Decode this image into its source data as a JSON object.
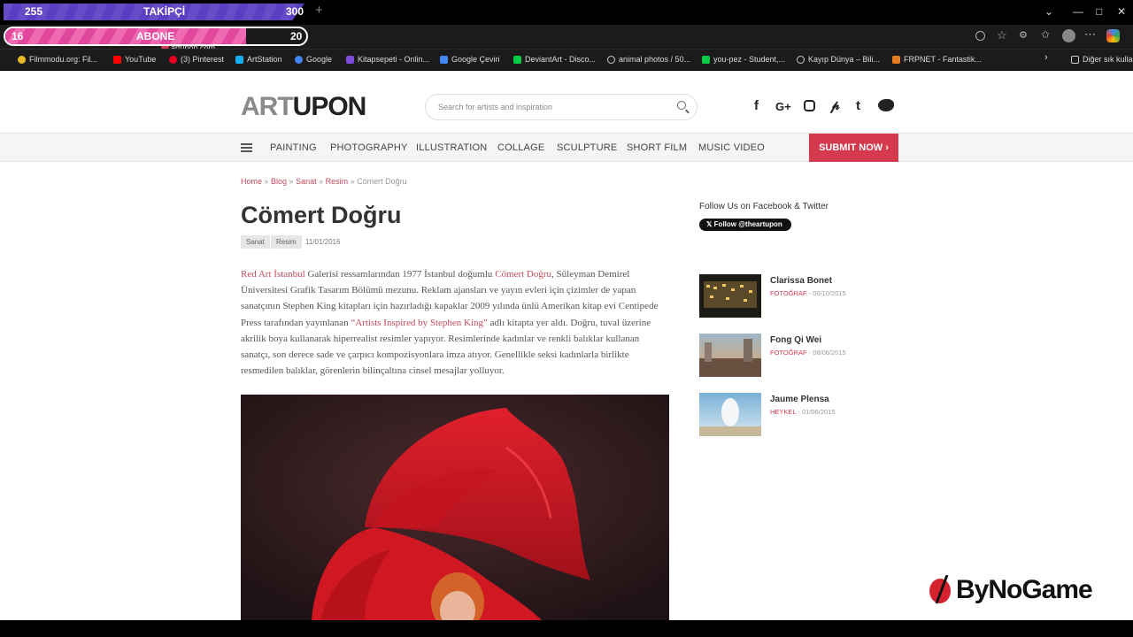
{
  "overlay": {
    "followers_current": "255",
    "followers_label": "TAKİPÇİ",
    "followers_goal": "300",
    "followers_progress": 0.85,
    "subs_current": "16",
    "subs_label": "ABONE",
    "subs_goal": "20",
    "subs_progress": 0.8,
    "subs_color": "#e0479d",
    "followers_color": "#5a3fc2"
  },
  "browser": {
    "url": "artupon.com",
    "bookmarks": [
      "Filmmodu.org: Fil...",
      "YouTube",
      "(3) Pinterest",
      "ArtStation",
      "Google",
      "Kitapsepeti - Onlin...",
      "Google Çeviri",
      "DeviantArt - Disco...",
      "animal photos / 50...",
      "you-pez - Student,...",
      "Kayıp Dünya – Bili...",
      "FRPNET - Fantastik..."
    ],
    "other_bookmarks": "Diğer sık kullan"
  },
  "site": {
    "logo_part1": "ART",
    "logo_part2": "UPON",
    "search_placeholder": "Search for artists and inspiration",
    "social_icons": [
      "facebook-icon",
      "google-plus-icon",
      "instagram-icon",
      "pinterest-icon",
      "tumblr-icon",
      "twitter-icon"
    ],
    "nav": [
      "PAINTING",
      "PHOTOGRAPHY",
      "ILLUSTRATION",
      "COLLAGE",
      "SCULPTURE",
      "SHORT FILM",
      "MUSIC VIDEO"
    ],
    "submit_label": "SUBMIT NOW ›",
    "accent": "#d4394d"
  },
  "article": {
    "breadcrumb": {
      "home": "Home",
      "blog": "Blog",
      "sanat": "Sanat",
      "resim": "Resim",
      "current": "Cömert Doğru"
    },
    "title": "Cömert Doğru",
    "tags": [
      "Sanat",
      "Resim"
    ],
    "date": "11/01/2016",
    "body": {
      "link1": "Red Art İstanbul",
      "t1": " Galerisi ressamlarından 1977 İstanbul doğumlu ",
      "link2": "Cömert Doğru",
      "t2": ", Süleyman Demirel Üniversitesi Grafik Tasarım Bölümü mezunu. Reklam ajansları ve yayın evleri için çizimler de yapan sanatçının Stephen King kitapları için hazırladığı kapaklar 2009 yılında ünlü Amerikan kitap evi Centipede Press tarafından yayınlanan ",
      "link3": "“Artists Inspired by Stephen King”",
      "t3": " adlı kitapta yer aldı. Doğru, tuval üzerine akrilik boya kullanarak hiperrealist resimler yapıyor. Resimlerinde kadınlar ve renkli balıklar kullanan sanatçı, son derece sade ve çarpıcı kompozisyonlara imza atıyor. Genellikle seksi kadınlarla birlikte resmedilen balıklar, görenlerin bilinçaltına cinsel mesajlar yolluyor."
    }
  },
  "sidebar": {
    "follow_label": "Follow Us on Facebook & Twitter",
    "twitter_button": "Follow @theartupon",
    "items": [
      {
        "name": "Clarissa Bonet",
        "category": "FOTOĞRAF",
        "date": " - 06/10/2015"
      },
      {
        "name": "Fong Qi Wei",
        "category": "FOTOĞRAF",
        "date": " - 08/06/2015"
      },
      {
        "name": "Jaume Plensa",
        "category": "HEYKEL",
        "date": " - 01/06/2015"
      }
    ]
  },
  "watermark": "ByNoGame"
}
